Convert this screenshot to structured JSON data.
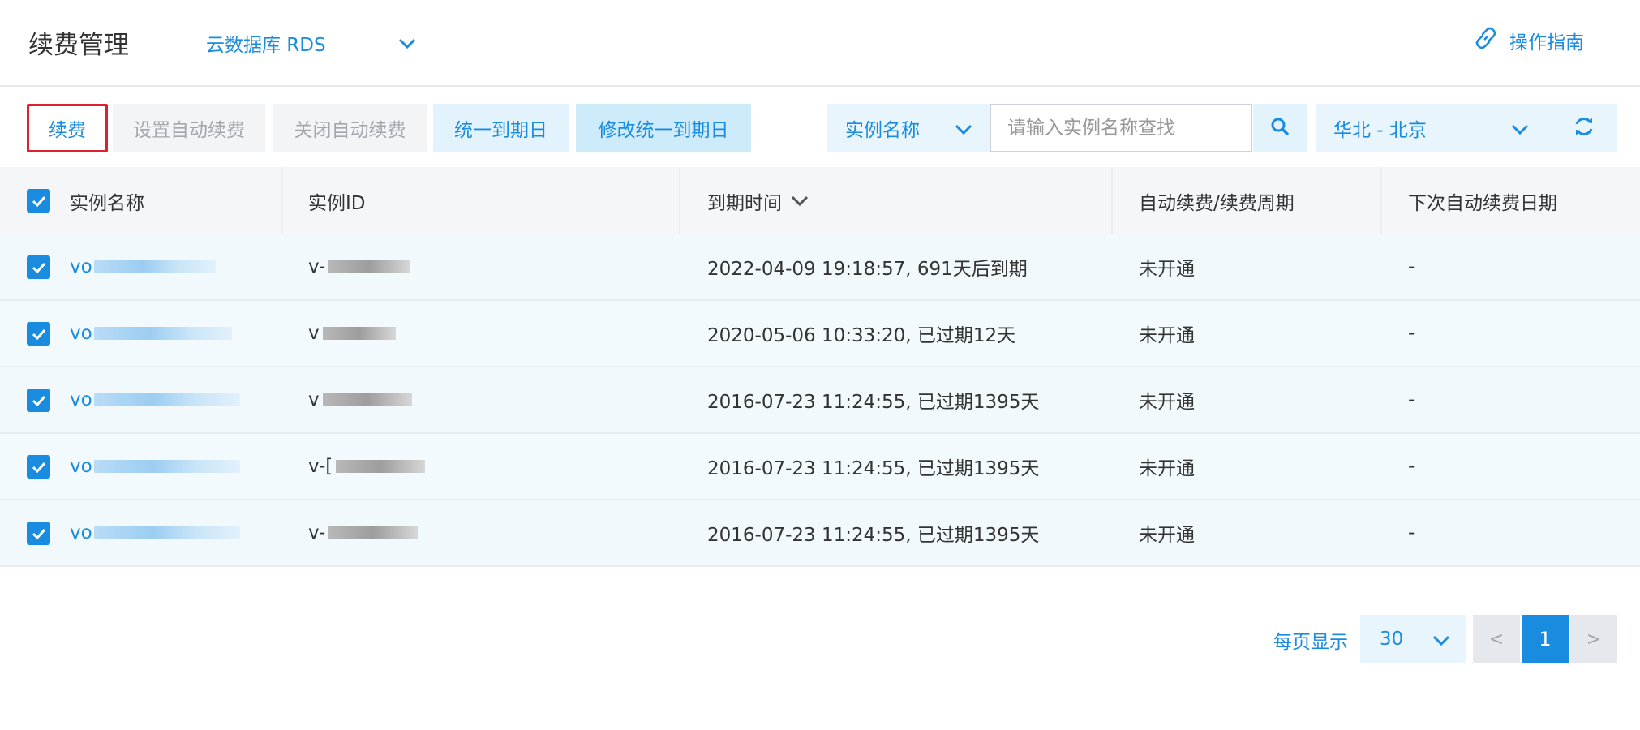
{
  "header": {
    "title": "续费管理",
    "product": "云数据库 RDS",
    "guide": "操作指南"
  },
  "toolbar": {
    "renew": "续费",
    "set_auto_renew": "设置自动续费",
    "close_auto_renew": "关闭自动续费",
    "unify_expiry": "统一到期日",
    "modify_unify_expiry": "修改统一到期日",
    "search_field": "实例名称",
    "search_placeholder": "请输入实例名称查找",
    "region": "华北 - 北京"
  },
  "table": {
    "columns": [
      "实例名称",
      "实例ID",
      "到期时间",
      "自动续费/续费周期",
      "下次自动续费日期"
    ],
    "rows": [
      {
        "name": "vo",
        "id": "v-",
        "expiry": "2022-04-09 19:18:57, 691天后到期",
        "auto": "未开通",
        "next": "-"
      },
      {
        "name": "vo",
        "id": "v",
        "expiry": "2020-05-06 10:33:20, 已过期12天",
        "auto": "未开通",
        "next": "-"
      },
      {
        "name": "vo",
        "id": "v",
        "expiry": "2016-07-23 11:24:55, 已过期1395天",
        "auto": "未开通",
        "next": "-"
      },
      {
        "name": "vo",
        "id": "v-[",
        "expiry": "2016-07-23 11:24:55, 已过期1395天",
        "auto": "未开通",
        "next": "-"
      },
      {
        "name": "vo",
        "id": "v-",
        "expiry": "2016-07-23 11:24:55, 已过期1395天",
        "auto": "未开通",
        "next": "-"
      }
    ]
  },
  "pager": {
    "per_page_label": "每页显示",
    "per_page": "30",
    "prev": "<",
    "current": "1",
    "next": ">"
  },
  "colors": {
    "accent": "#1a8ce0",
    "highlight_border": "#e0202e"
  },
  "icons": [
    "chevron-down-icon",
    "link-icon",
    "search-icon",
    "refresh-icon",
    "check-icon"
  ]
}
